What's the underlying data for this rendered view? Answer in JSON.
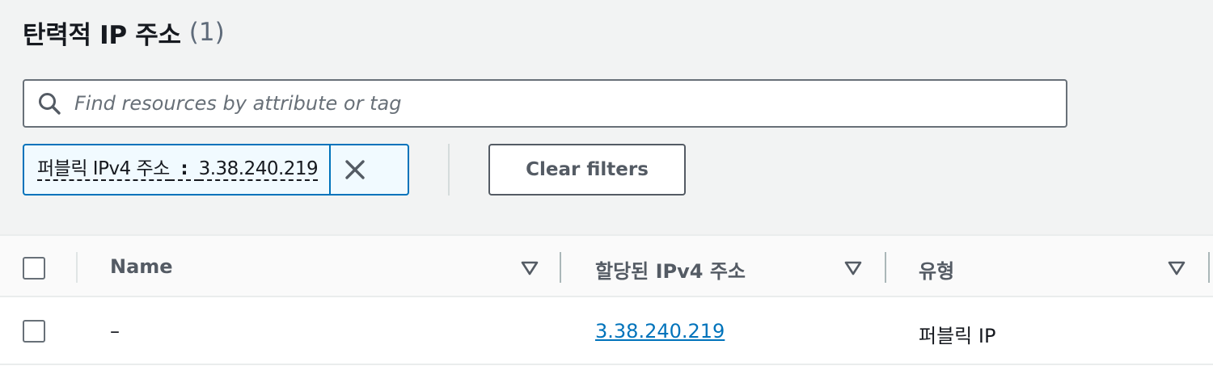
{
  "header": {
    "title": "탄력적 IP 주소",
    "count": "(1)"
  },
  "search": {
    "placeholder": "Find resources by attribute or tag",
    "value": ""
  },
  "filter_token": {
    "key": "퍼블릭 IPv4 주소",
    "operator": ":",
    "value": "3.38.240.219"
  },
  "toolbar": {
    "clear_filters_label": "Clear filters"
  },
  "table": {
    "columns": [
      {
        "label": "Name"
      },
      {
        "label": "할당된 IPv4 주소"
      },
      {
        "label": "유형"
      }
    ],
    "rows": [
      {
        "name": "–",
        "allocated_ipv4": "3.38.240.219",
        "type": "퍼블릭 IP",
        "selected": false
      }
    ]
  },
  "colors": {
    "accent": "#0073bb",
    "token_background": "#f1faff",
    "page_background": "#f2f3f3",
    "header_text": "#16191f",
    "muted_text": "#5f6b7a"
  }
}
